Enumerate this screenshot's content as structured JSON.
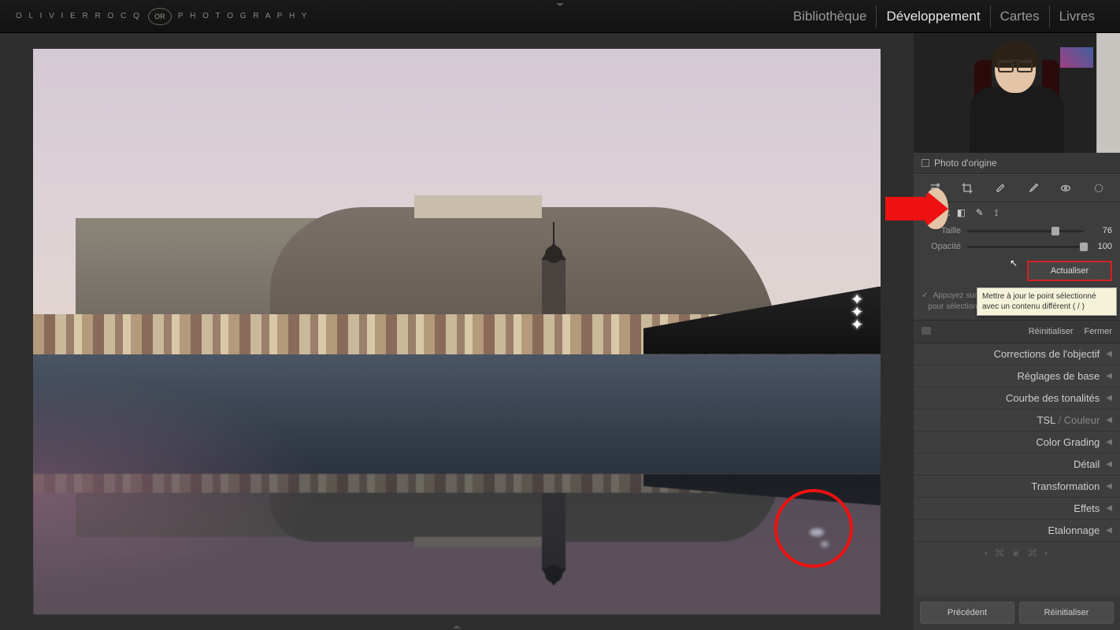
{
  "brand": {
    "left": "O L I V I E R  R O C Q",
    "right": "P H O T O G R A P H Y",
    "logo_text": "OR"
  },
  "nav": {
    "items": [
      "Bibliothèque",
      "Développement",
      "Cartes",
      "Livres"
    ],
    "active": "Développement"
  },
  "original_label": "Photo d'origine",
  "mode_label": "Mode :",
  "sliders": {
    "taille": {
      "label": "Taille",
      "value": 76,
      "pct": 76
    },
    "opacite": {
      "label": "Opacité",
      "value": 100,
      "pct": 100
    }
  },
  "refresh_button": "Actualiser",
  "tooltip_text": "Mettre à jour le point sélectionné avec un contenu différent ( / )",
  "hint_line1": "Appuyez sur la to",
  "hint_line2": "pour sélectionner",
  "reset_row": {
    "reinit": "Réinitialiser",
    "close": "Fermer"
  },
  "panels": [
    {
      "label": "Corrections de l'objectif"
    },
    {
      "label_a": "Réglages de base"
    },
    {
      "label": "Courbe des tonalités"
    },
    {
      "tsl_a": "TSL",
      "tsl_b": "Couleur"
    },
    {
      "label": "Color Grading"
    },
    {
      "label": "Détail"
    },
    {
      "label": "Transformation"
    },
    {
      "label": "Effets"
    },
    {
      "label": "Etalonnage"
    }
  ],
  "footer": {
    "prev": "Précédent",
    "reinit": "Réinitialiser"
  }
}
